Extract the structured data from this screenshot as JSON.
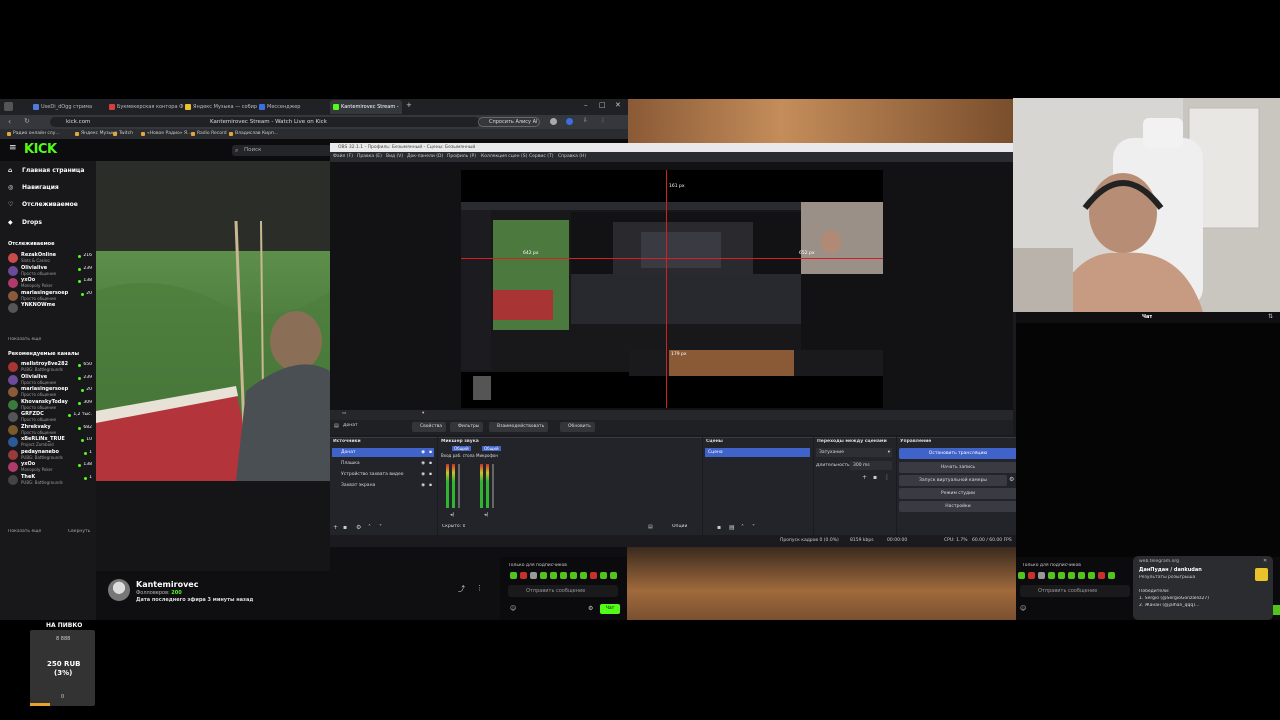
{
  "browser": {
    "tabs": [
      {
        "label": "UseDi_dOgg стрима",
        "color": "#4f7bd9"
      },
      {
        "label": "Букмекерская контора Ф",
        "color": "#d93c3c"
      },
      {
        "label": "Яндекс Музыка — собир",
        "color": "#e9c22c"
      },
      {
        "label": "Мессенджер",
        "color": "#3b6fe0"
      },
      {
        "label": "Kantemirovec Stream - ",
        "color": "#53fc18"
      }
    ],
    "url": "kick.com",
    "page_title": "Kantemirovec Stream - Watch Live on Kick",
    "ask_label": "Спросить Алису AI",
    "bookmarks": [
      "Радио онлайн слу...",
      "Яндекс Музыка",
      "Twitch",
      "«Новое Радио» Я...",
      "Radio Record",
      "Владислав Кирп..."
    ]
  },
  "kick": {
    "logo": "KICK",
    "search_placeholder": "Поиск",
    "nav": [
      {
        "label": "Главная страница",
        "icon": "home-icon"
      },
      {
        "label": "Навигация",
        "icon": "compass-icon"
      },
      {
        "label": "Отслеживаемое",
        "icon": "heart-icon"
      },
      {
        "label": "Drops",
        "icon": "drop-icon"
      }
    ],
    "following_header": "Отслеживаемое",
    "following": [
      {
        "name": "RezakOnline",
        "sub": "Slots & Casino",
        "viewers": "216",
        "color": "#c94b4b"
      },
      {
        "name": "Olivialive",
        "sub": "Просто общение",
        "viewers": "239",
        "color": "#6b4b9a"
      },
      {
        "name": "yxOo",
        "sub": "Monopoly Poker",
        "viewers": "138",
        "color": "#b23a6a"
      },
      {
        "name": "mariasingersoep",
        "sub": "Просто общение",
        "viewers": "20",
        "color": "#8a5a3a"
      },
      {
        "name": "YNKNOWme",
        "sub": "",
        "viewers": "",
        "color": "#555"
      }
    ],
    "show_more": "Показать ещё",
    "recommended_header": "Рекомендуемые каналы",
    "recommended": [
      {
        "name": "mellstroy8ve282",
        "sub": "PUBG: Battlegrounds",
        "viewers": "650",
        "color": "#a33"
      },
      {
        "name": "Olivialive",
        "sub": "Просто общение",
        "viewers": "239",
        "color": "#6b4b9a"
      },
      {
        "name": "mariasingersoep",
        "sub": "Просто общение",
        "viewers": "20",
        "color": "#8a5a3a"
      },
      {
        "name": "KhovanskyToday",
        "sub": "Просто общение",
        "viewers": "309",
        "color": "#3a7a3a"
      },
      {
        "name": "GRFZDC",
        "sub": "Просто общение",
        "viewers": "1,2 тыс.",
        "color": "#555"
      },
      {
        "name": "Zhrekvaky",
        "sub": "Просто общение",
        "viewers": "682",
        "color": "#7a5a2a"
      },
      {
        "name": "xBeRLiNx_TRUE",
        "sub": "Project Zomboid",
        "viewers": "10",
        "color": "#2a5a9a"
      },
      {
        "name": "pedaynanebo",
        "sub": "PUBG: Battlegrounds",
        "viewers": "1",
        "color": "#9a3a3a"
      },
      {
        "name": "yxOo",
        "sub": "Monopoly Poker",
        "viewers": "138",
        "color": "#b23a6a"
      },
      {
        "name": "TheK",
        "sub": "PUBG: Battlegrounds",
        "viewers": "1",
        "color": "#444"
      }
    ],
    "show_more2": "Показать ещё",
    "collapse": "Свернуть",
    "streamer": {
      "name": "Kantemirovec",
      "followers_label": "Фолловеров:",
      "followers": "200",
      "last_stream": "Дата последнего эфира 3 минуты назад"
    }
  },
  "obs": {
    "title": "OBS 32.1.1 - Профиль: Безымянный - Сцены: Безымянный",
    "menu": [
      "Файл (F)",
      "Правка (E)",
      "Вид (V)",
      "Док-панели (D)",
      "Профиль (P)",
      "Коллекция сцен (S)",
      "Сервис (T)",
      "Справка (H)"
    ],
    "measure_top": "161 px",
    "measure_left": "642 px",
    "measure_right": "652 px",
    "measure_bottom": "179 px",
    "context_source": "Донат",
    "toolbar": [
      "Свойства",
      "Фильтры",
      "Взаимодействовать",
      "Обновить"
    ],
    "sources_title": "Источники",
    "sources": [
      {
        "label": "Донат",
        "selected": true
      },
      {
        "label": "Плашка",
        "selected": false
      },
      {
        "label": "Устройство захвата видео",
        "selected": false
      },
      {
        "label": "Захват экрана",
        "selected": false
      }
    ],
    "mixer_title": "Микшер звука",
    "mixer_channels": [
      "Общий",
      "Общий"
    ],
    "mixer_devices": [
      "Вход раб. стола",
      "Микрофон"
    ],
    "hidden_label": "Скрыто: 0",
    "filter_label": "Опции",
    "scenes_title": "Сцены",
    "scenes": [
      "Сцена"
    ],
    "transitions_title": "Переходы между сценами",
    "transition": "Затухание",
    "duration_label": "Длительность",
    "duration": "300 ms",
    "controls_title": "Управление",
    "controls": [
      {
        "label": "Остановить трансляцию",
        "active": true
      },
      {
        "label": "Начать запись",
        "active": false
      },
      {
        "label": "Запуск виртуальной камеры",
        "active": false
      },
      {
        "label": "Режим студии",
        "active": false
      },
      {
        "label": "Настройки",
        "active": false
      }
    ],
    "status": {
      "dropped": "Пропуск кадров 0 (0.0%)",
      "bitrate": "8159 kbps",
      "stream_time": "00:00:00",
      "cpu": "CPU: 1.7%",
      "fps": "60.00 / 60.00 FPS"
    }
  },
  "chat": {
    "header": "Чат",
    "subscribers_only": "Только для подписчиков",
    "send_placeholder": "Отправить сообщение",
    "send_button": "Чат",
    "subscribers_only_right": "Только для подписчиков",
    "send_placeholder_right": "Отправить сообщение"
  },
  "notification": {
    "source": "web.telegram.org",
    "title": "ДанПудан / dankudan",
    "subtitle": "Результаты розыгрыша",
    "body_title": "Победители:",
    "winner1": "1. Sergio (@SergioGonzalez27)",
    "winner2": "2. Жанан (@jalhan_qqq)..."
  },
  "donation": {
    "title": "НА ПИВКО",
    "goal": "8 888",
    "amount": "250 RUB",
    "percent": "(3%)",
    "start": "0",
    "progress": 0.03
  }
}
